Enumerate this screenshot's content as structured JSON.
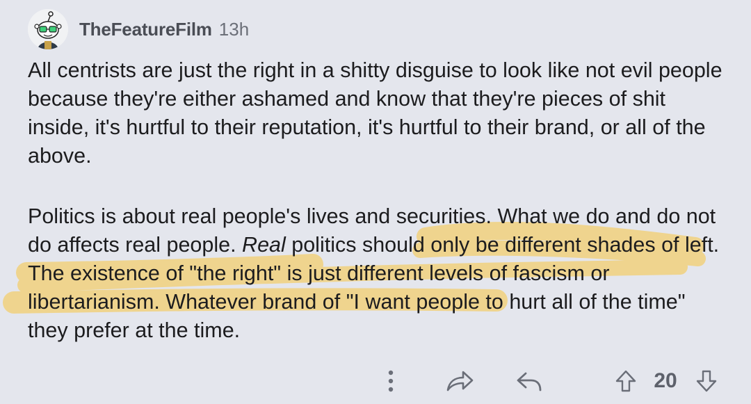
{
  "comment": {
    "username": "TheFeatureFilm",
    "time_ago": "13h",
    "paragraph1": "All centrists are just the right in a shitty disguise to look like not evil people because they're either ashamed and know that they're pieces of shit inside, it's hurtful to their reputation, it's hurtful to their brand, or all of the above.",
    "paragraph2": {
      "part_before": "Politics is about real people's lives and securities. What we do and do not do affects real people. ",
      "italic": "Real",
      "part_after": " politics should only be different shades of left. The existence of \"the right\" is just different levels of fascism or libertarianism. Whatever brand of \"I want people to hurt all of the time\" they prefer at the time."
    },
    "highlight_color": "#f3cf6f"
  },
  "actions": {
    "icons": [
      "more-options-icon",
      "share-icon",
      "reply-icon",
      "upvote-icon",
      "downvote-icon"
    ],
    "vote_count": "20"
  }
}
